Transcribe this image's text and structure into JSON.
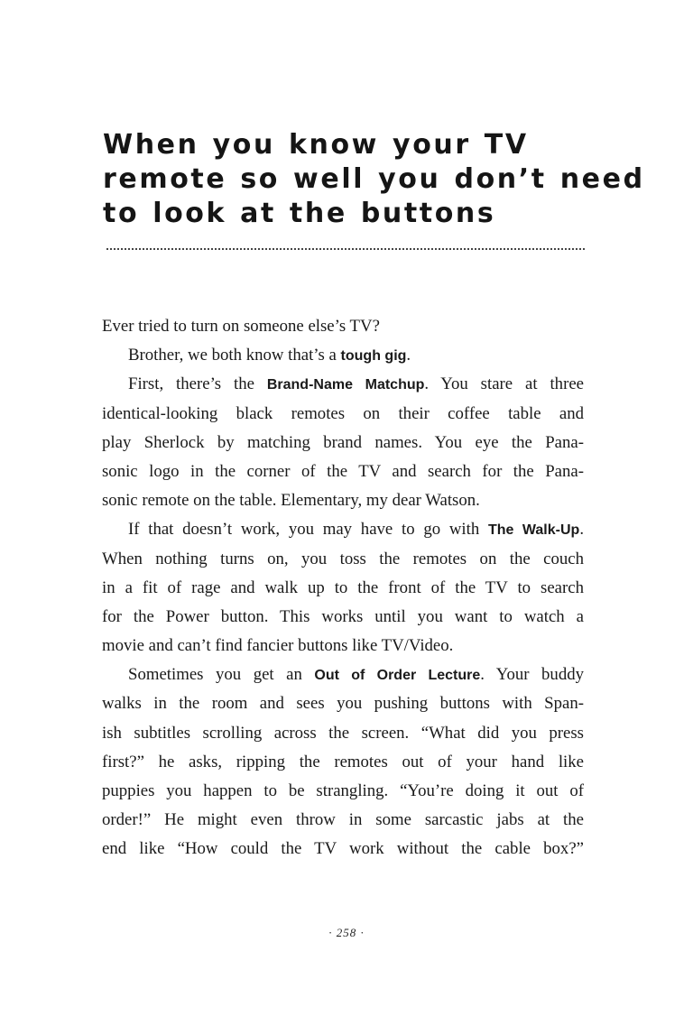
{
  "title": {
    "lines": [
      "When you know your TV",
      "remote so well you don’t need",
      "to look at the buttons"
    ]
  },
  "body": {
    "p1": "Ever tried to turn on someone else’s TV?",
    "p2": {
      "before": "Brother, we both know that’s a ",
      "term": "tough gig",
      "after": "."
    },
    "p3": {
      "l1_before": "First, there’s the ",
      "l1_term": "Brand-Name Matchup",
      "l1_after": ". You stare at three",
      "l2": "identical-looking black remotes on their coffee table and",
      "l3": "play Sherlock by matching brand names. You eye the Pana-",
      "l4": "sonic logo in the corner of the TV and search for the Pana-",
      "l5": "sonic remote on the table. Elementary, my dear Watson."
    },
    "p4": {
      "l1_before": "If that doesn’t work, you may have to go with ",
      "l1_term": "The Walk-Up",
      "l1_after": ".",
      "l2": "When nothing turns on, you toss the remotes on the couch",
      "l3": "in a fit of rage and walk up to the front of the TV to search",
      "l4": "for the Power button. This works until you want to watch a",
      "l5": "movie and can’t find fancier buttons like TV/Video."
    },
    "p5": {
      "l1_before": "Sometimes you get an ",
      "l1_term": "Out of Order Lecture",
      "l1_after": ". Your buddy",
      "l2": "walks in the room and sees you pushing buttons with Span-",
      "l3": "ish subtitles scrolling across the screen. “What did you press",
      "l4": "first?” he asks, ripping the remotes out of your hand like",
      "l5": "puppies you happen to be strangling. “You’re doing it out of",
      "l6": "order!” He might even throw in some sarcastic jabs at the",
      "l7": "end like “How could the TV work without the cable box?”"
    }
  },
  "folio": "· 258 ·"
}
